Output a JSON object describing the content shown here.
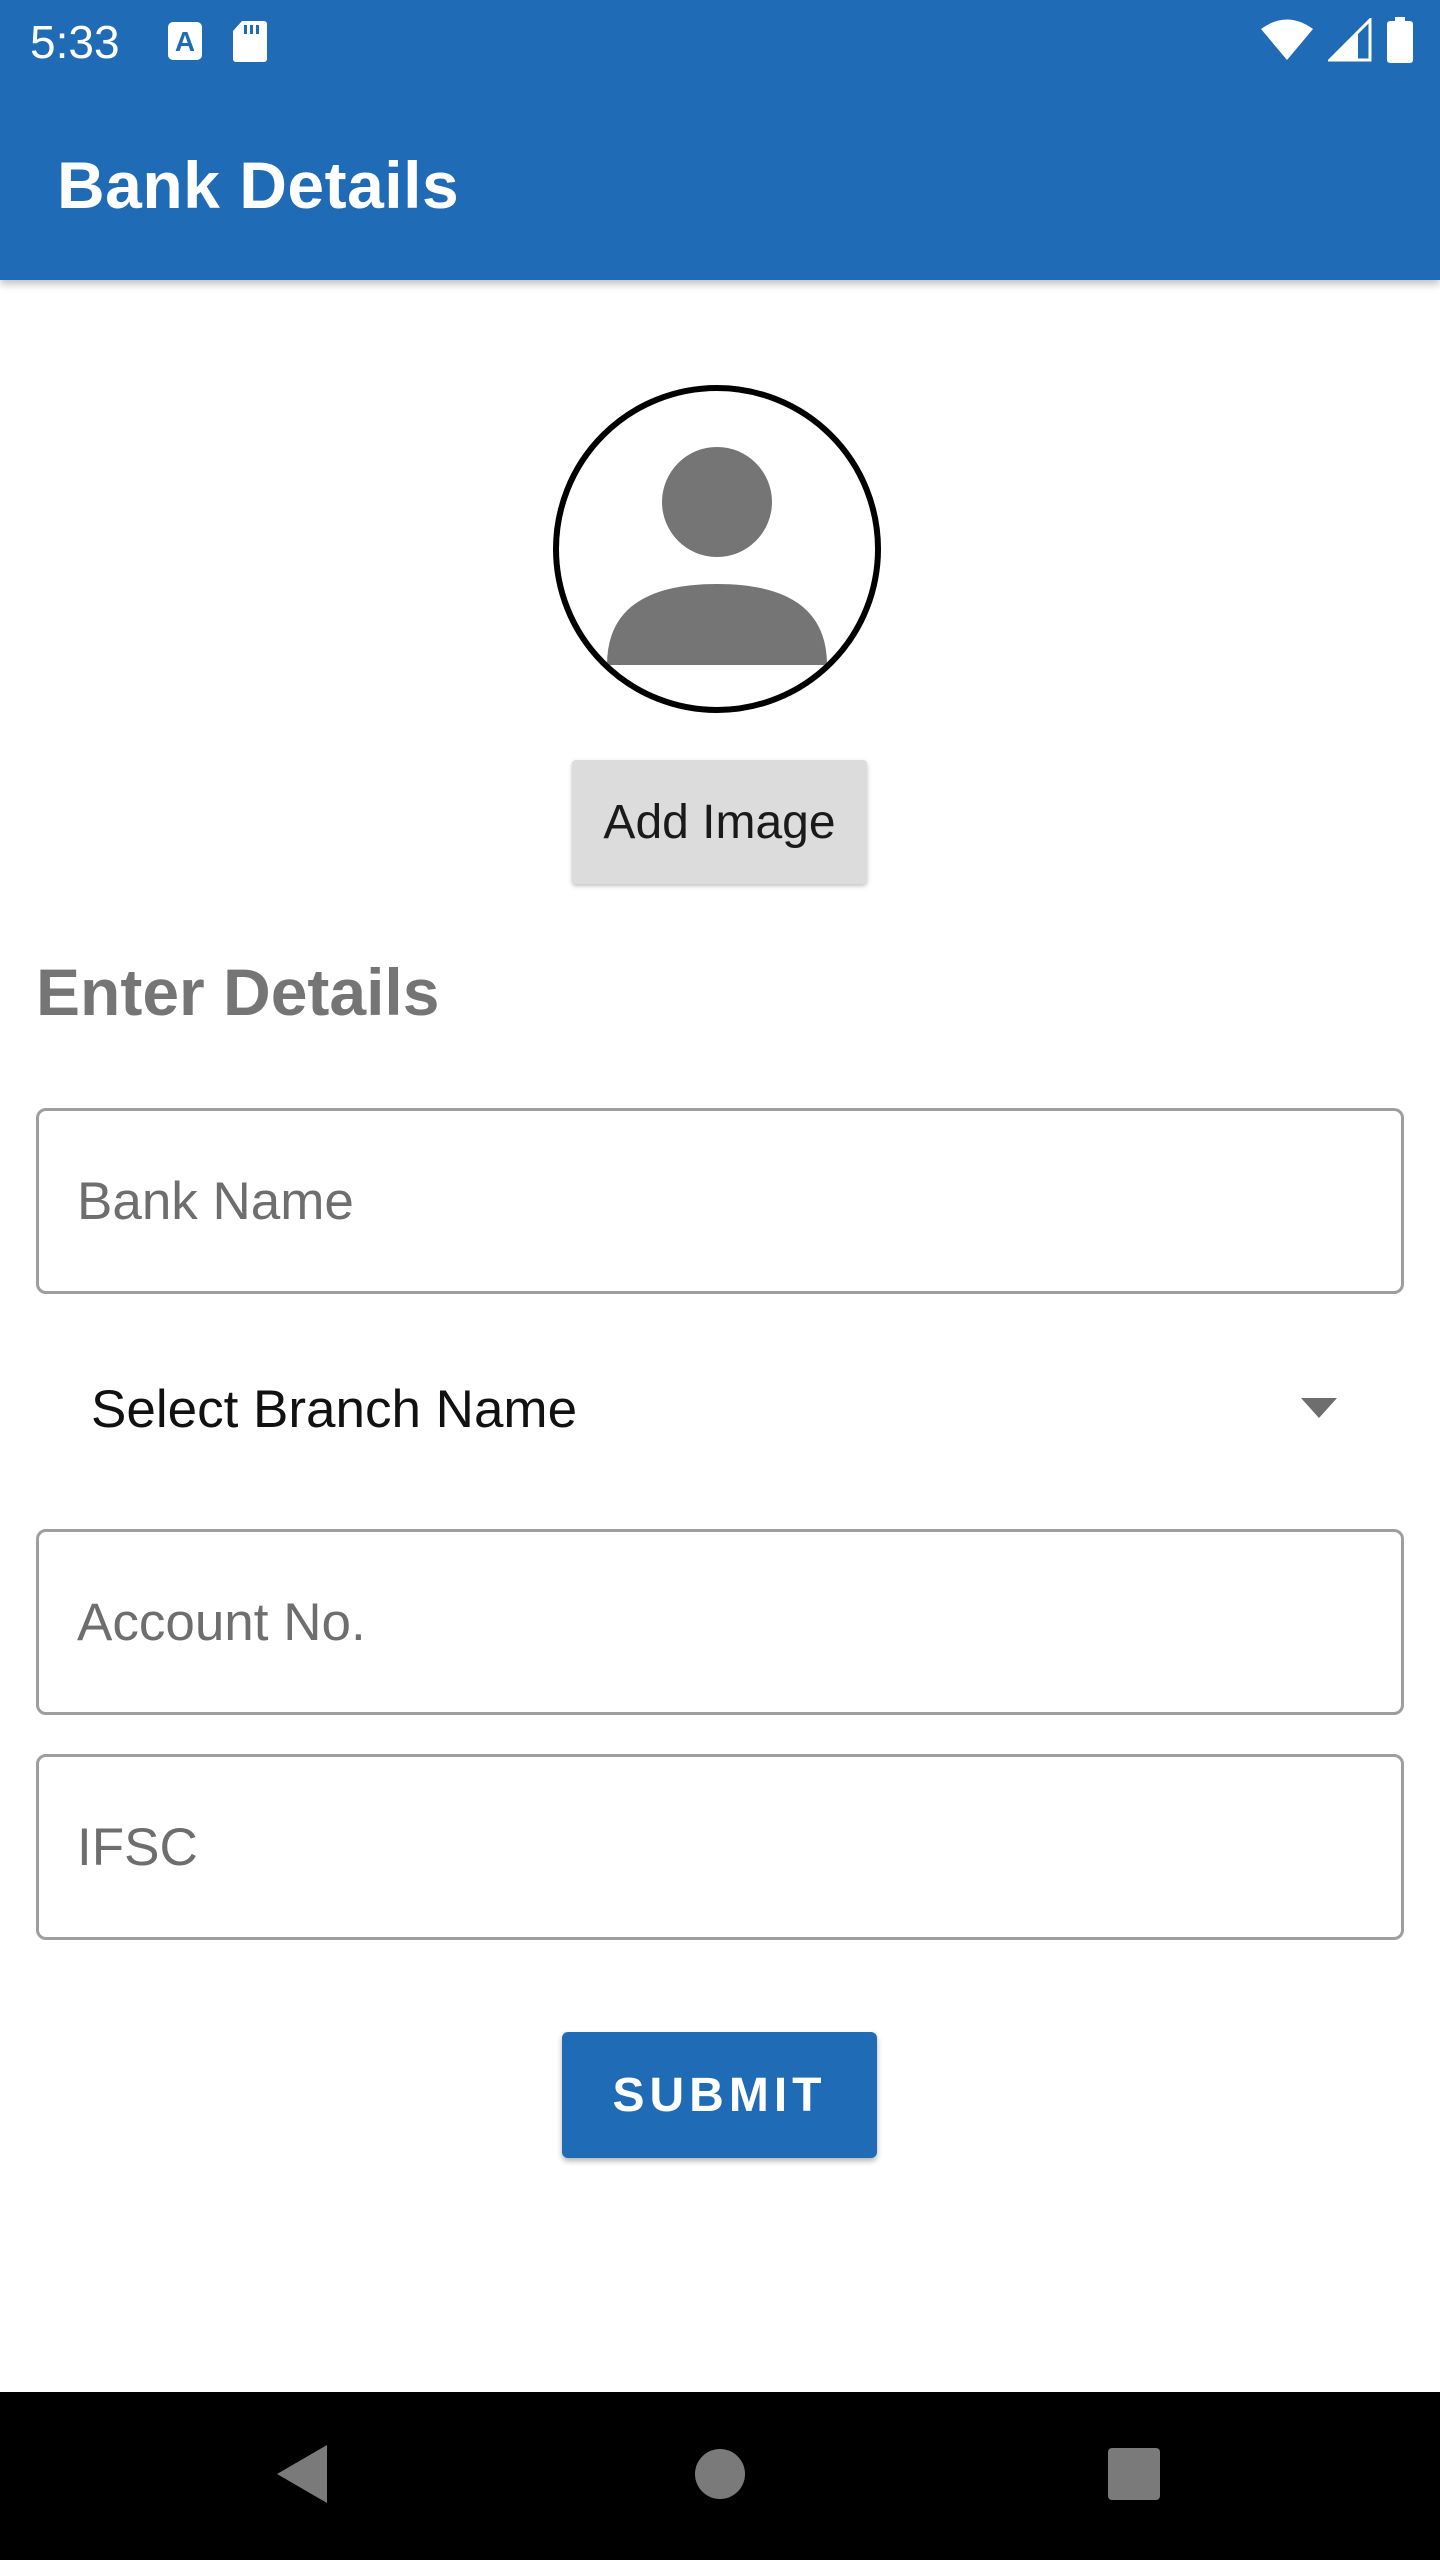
{
  "status_bar": {
    "time": "5:33",
    "left_icons": [
      "text-a-icon",
      "sd-card-icon"
    ],
    "right_icons": [
      "wifi-icon",
      "cell-signal-icon",
      "battery-icon"
    ]
  },
  "app_bar": {
    "title": "Bank Details",
    "color": "#1f6bb5"
  },
  "profile": {
    "avatar_icon": "person-icon",
    "add_image_label": "Add Image"
  },
  "form": {
    "section_title": "Enter Details",
    "bank_name": {
      "placeholder": "Bank Name",
      "value": ""
    },
    "branch_select": {
      "selected": "Select Branch Name"
    },
    "account_no": {
      "placeholder": "Account No.",
      "value": ""
    },
    "ifsc": {
      "placeholder": "IFSC",
      "value": ""
    },
    "submit_label": "SUBMIT"
  },
  "nav_bar": {
    "buttons": [
      "back-icon",
      "home-icon",
      "recents-icon"
    ]
  }
}
